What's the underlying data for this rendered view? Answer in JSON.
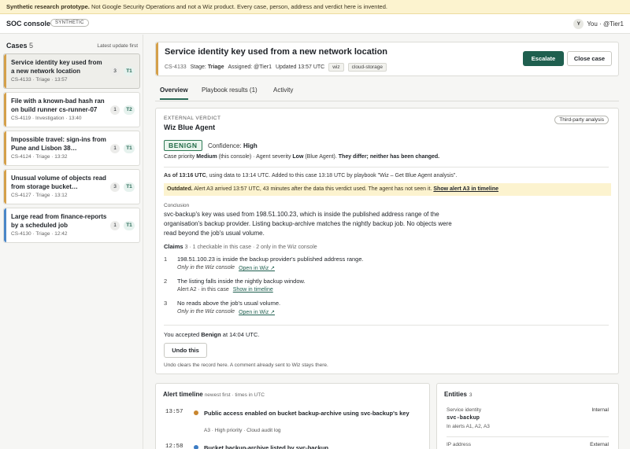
{
  "banner": {
    "bold": "Synthetic research prototype.",
    "text": " Not Google Security Operations and not a Wiz product. Every case, person, address and verdict here is invented."
  },
  "topbar": {
    "brand": "SOC console",
    "badge": "SYNTHETIC",
    "avatar_letter": "Y",
    "user": "You · @Tier1"
  },
  "sidebar": {
    "title": "Cases",
    "count": "5",
    "sort_label": "Latest update first",
    "cases": [
      {
        "title": "Service identity key used from a new network location",
        "meta": "CS-4133 · Triage · 13:57",
        "alerts": "3",
        "tier": "T1",
        "color": "orange",
        "selected": true
      },
      {
        "title": "File with a known-bad hash ran on build runner cs-runner-07",
        "meta": "CS-4119 · Investigation · 13:40",
        "alerts": "1",
        "tier": "T2",
        "color": "orange",
        "selected": false
      },
      {
        "title": "Impossible travel: sign-ins from Pune and Lisbon 38…",
        "meta": "CS-4124 · Triage · 13:32",
        "alerts": "1",
        "tier": "T1",
        "color": "orange",
        "selected": false
      },
      {
        "title": "Unusual volume of objects read from storage bucket…",
        "meta": "CS-4127 · Triage · 13:12",
        "alerts": "3",
        "tier": "T1",
        "color": "orange",
        "selected": false
      },
      {
        "title": "Large read from finance-reports by a scheduled job",
        "meta": "CS-4130 · Triage · 12:42",
        "alerts": "1",
        "tier": "T1",
        "color": "blue",
        "selected": false
      }
    ]
  },
  "case_header": {
    "title": "Service identity key used from a new network location",
    "id": "CS-4133",
    "stage_label": "Stage:",
    "stage": "Triage",
    "assigned_label": "Assigned:",
    "assigned": "@Tier1",
    "updated": "Updated 13:57 UTC",
    "tags": [
      "wiz",
      "cloud-storage"
    ],
    "escalate_label": "Escalate",
    "close_label": "Close case"
  },
  "tabs": [
    "Overview",
    "Playbook results (1)",
    "Activity"
  ],
  "verdict": {
    "ext_label": "EXTERNAL VERDICT",
    "agent": "Wiz Blue Agent",
    "third_party": "Third-party analysis",
    "badge": "BENIGN",
    "confidence_label": "Confidence:",
    "confidence": "High",
    "priority_prefix": "Case priority ",
    "priority_case": "Medium",
    "priority_mid": " (this console) · Agent severity ",
    "priority_agent": "Low",
    "priority_mid2": " (Blue Agent). ",
    "priority_diff": "They differ; neither has been changed.",
    "asof_bold": "As of 13:16 UTC",
    "asof_rest": ", using data to 13:14 UTC. Added to this case 13:18 UTC by playbook \"Wiz – Get Blue Agent analysis\".",
    "outdated_bold": "Outdated.",
    "outdated_text": " Alert A3 arrived 13:57 UTC, 43 minutes after the data this verdict used. The agent has not seen it. ",
    "outdated_link": "Show alert A3 in timeline",
    "conclusion_label": "Conclusion",
    "conclusion": "svc-backup's key was used from 198.51.100.23, which is inside the published address range of the organisation's backup provider. Listing backup-archive matches the nightly backup job. No objects were read beyond the job's usual volume.",
    "claims_title": "Claims",
    "claims_sub": "3 · 1 checkable in this case · 2 only in the Wiz console",
    "claims": [
      {
        "num": "1",
        "text": "198.51.100.23 is inside the backup provider's published address range.",
        "note": "Only in the Wiz console",
        "link": "Open in Wiz ↗"
      },
      {
        "num": "2",
        "text": "The listing falls inside the nightly backup window.",
        "note": "Alert A2 · in this case",
        "link": "Show in timeline"
      },
      {
        "num": "3",
        "text": "No reads above the job's usual volume.",
        "note": "Only in the Wiz console",
        "link": "Open in Wiz ↗"
      }
    ],
    "accepted_prefix": "You accepted ",
    "accepted_value": "Benign",
    "accepted_suffix": " at 14:04 UTC.",
    "undo_label": "Undo this",
    "undo_note": "Undo clears the record here. A comment already sent to Wiz stays there."
  },
  "timeline": {
    "title": "Alert timeline",
    "sub": "newest first · times in UTC",
    "rows": [
      {
        "time": "13:57",
        "text": "Public access enabled on bucket backup-archive using svc-backup's key",
        "meta": "A3 · High priority · Cloud audit log",
        "dot": "#c8862f"
      },
      {
        "time": "12:58",
        "text": "Bucket backup-archive listed by svc-backup",
        "meta": "",
        "dot": "#3d7cc4"
      }
    ]
  },
  "entities": {
    "title": "Entities",
    "count": "3",
    "rows": [
      {
        "label": "Service identity",
        "scope": "Internal",
        "value": "svc-backup",
        "where": "In alerts A1, A2, A3"
      },
      {
        "label": "IP address",
        "scope": "External",
        "value": "",
        "where": ""
      }
    ]
  }
}
